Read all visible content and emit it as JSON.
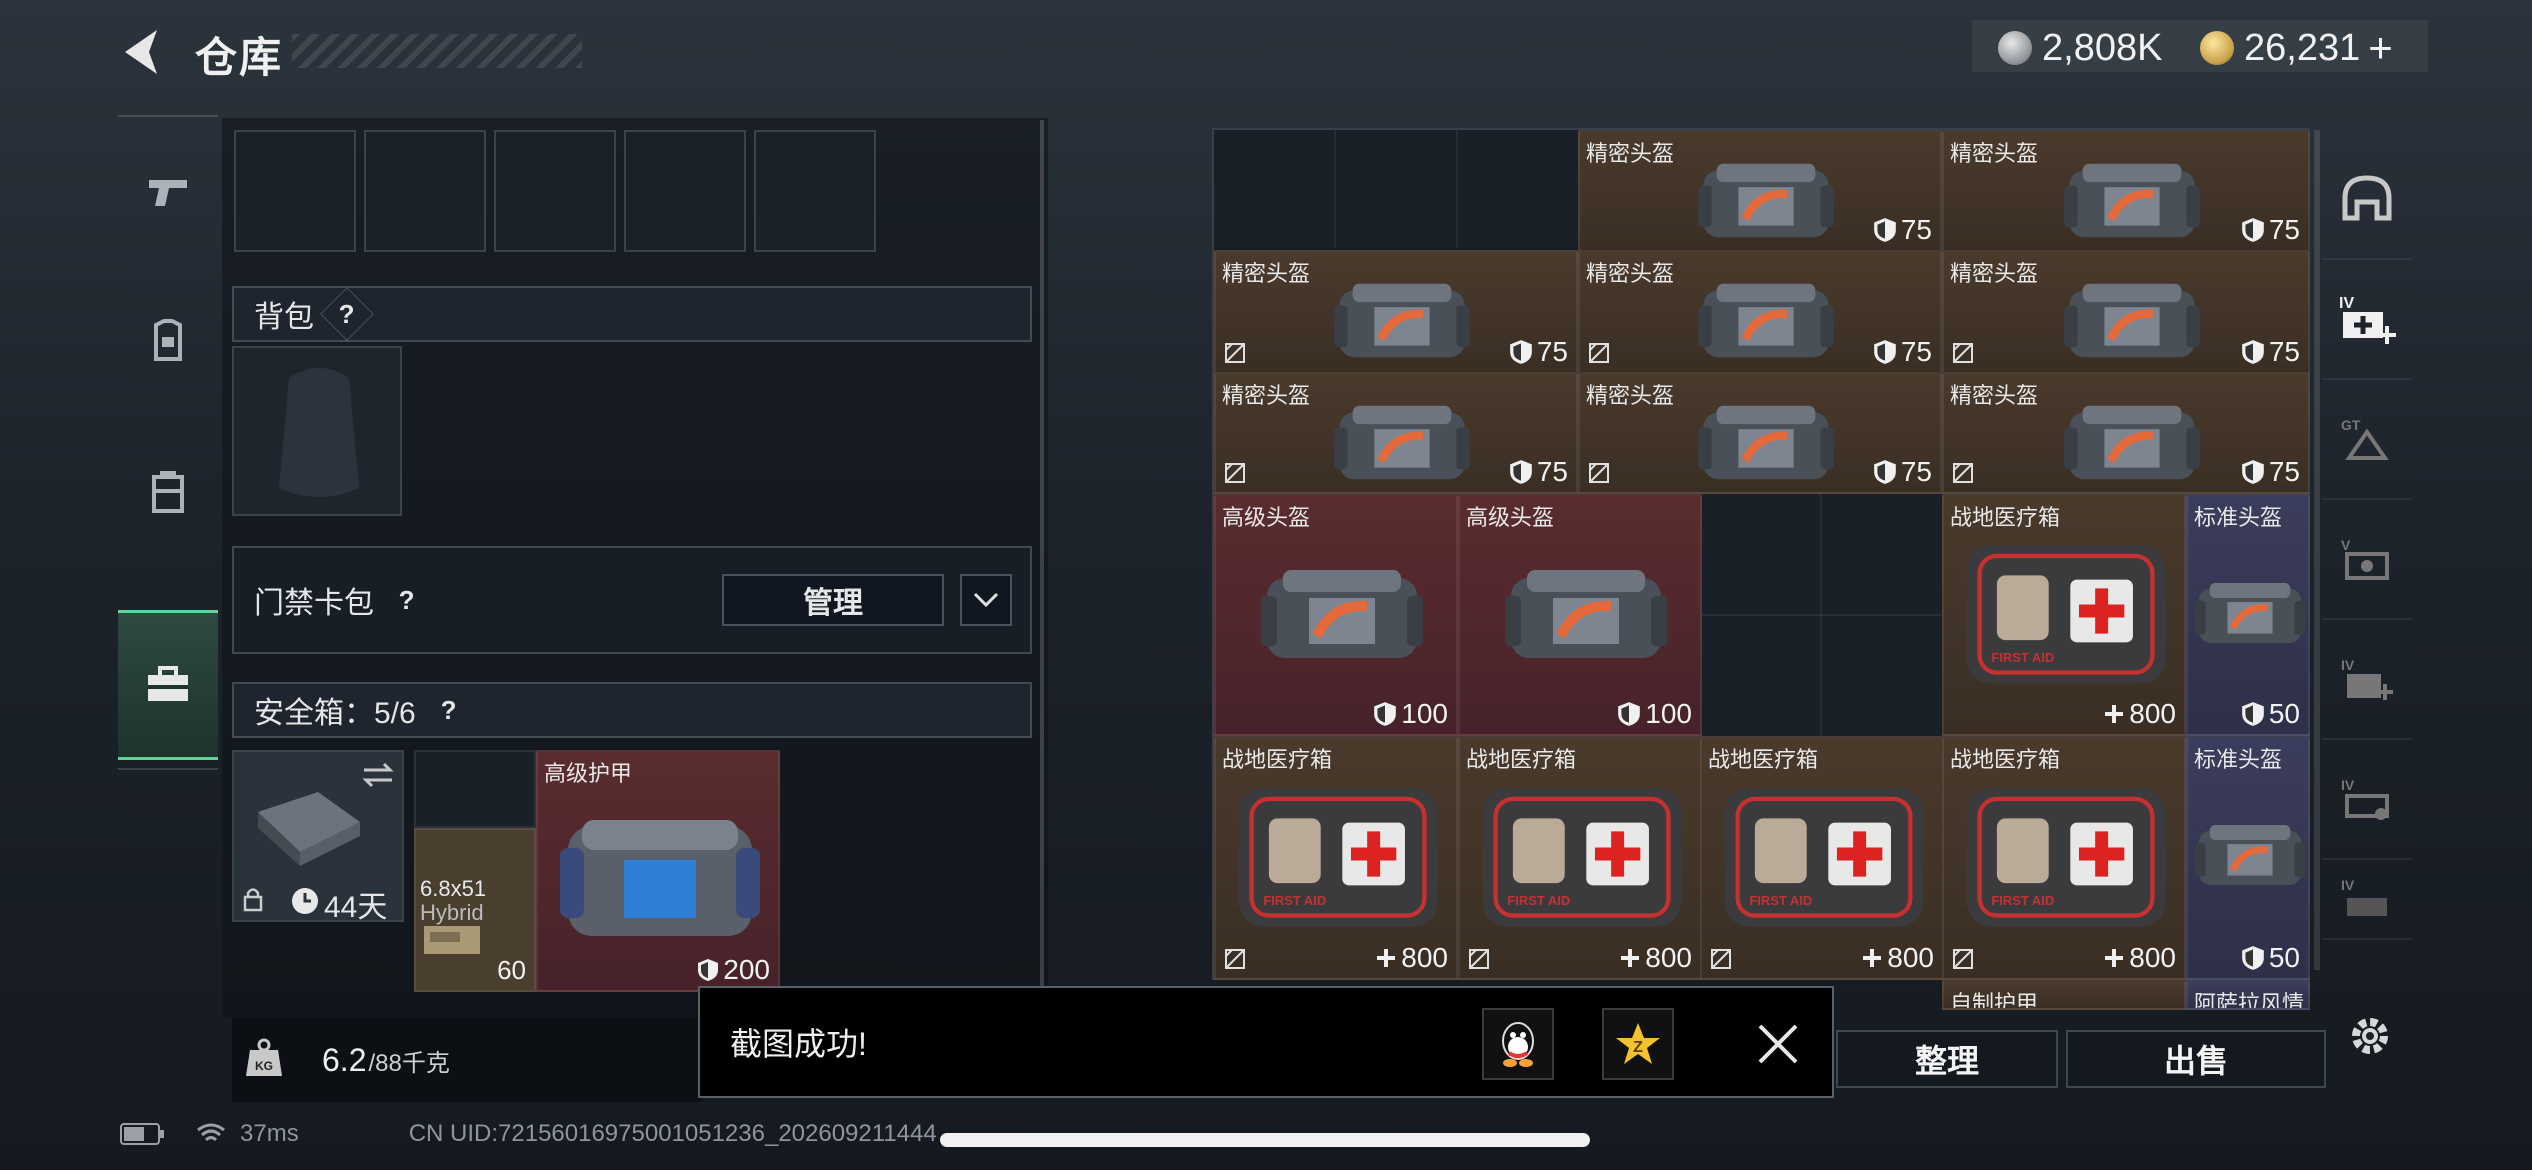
{
  "header": {
    "title": "仓库",
    "currency_silver": "2,808K",
    "currency_gold": "26,231",
    "gold_plus": "+"
  },
  "left": {
    "backpack_label": "背包",
    "help": "?",
    "access_label": "门禁卡包",
    "manage_label": "管理",
    "safe_label": "安全箱：5/6",
    "safe_case_time": "44天",
    "ammo_name": "6.8x51",
    "ammo_sub": "Hybrid",
    "ammo_count": "60",
    "armor_name": "高级护甲",
    "armor_value": "200",
    "weight_value": "6.2",
    "weight_cap": "/88千克"
  },
  "grid": {
    "items": [
      {
        "name": "精密头盔",
        "val": "75",
        "kind": "helmet",
        "color": "brown"
      },
      {
        "name": "精密头盔",
        "val": "75",
        "kind": "helmet",
        "color": "brown"
      },
      {
        "name": "精密头盔",
        "val": "75",
        "kind": "helmet",
        "color": "brown"
      },
      {
        "name": "精密头盔",
        "val": "75",
        "kind": "helmet",
        "color": "brown"
      },
      {
        "name": "精密头盔",
        "val": "75",
        "kind": "helmet",
        "color": "brown"
      },
      {
        "name": "精密头盔",
        "val": "75",
        "kind": "helmet",
        "color": "brown"
      },
      {
        "name": "精密头盔",
        "val": "75",
        "kind": "helmet",
        "color": "brown"
      },
      {
        "name": "精密头盔",
        "val": "75",
        "kind": "helmet",
        "color": "brown"
      },
      {
        "name": "高级头盔",
        "val": "100",
        "kind": "helmet",
        "color": "red"
      },
      {
        "name": "高级头盔",
        "val": "100",
        "kind": "helmet",
        "color": "red"
      },
      {
        "name": "战地医疗箱",
        "val": "800",
        "kind": "med",
        "color": "brown"
      },
      {
        "name": "标准头盔",
        "val": "50",
        "kind": "helmet",
        "color": "violet"
      },
      {
        "name": "战地医疗箱",
        "val": "800",
        "kind": "med",
        "color": "brown"
      },
      {
        "name": "战地医疗箱",
        "val": "800",
        "kind": "med",
        "color": "brown"
      },
      {
        "name": "战地医疗箱",
        "val": "800",
        "kind": "med",
        "color": "brown"
      },
      {
        "name": "战地医疗箱",
        "val": "800",
        "kind": "med",
        "color": "brown"
      },
      {
        "name": "标准头盔",
        "val": "50",
        "kind": "helmet",
        "color": "violet"
      },
      {
        "name": "自制护甲",
        "val": "",
        "kind": "partial",
        "color": "brown"
      },
      {
        "name": "阿萨拉风情",
        "val": "",
        "kind": "partial",
        "color": "violet"
      }
    ]
  },
  "toast": {
    "message": "截图成功!"
  },
  "buttons": {
    "sort": "整理",
    "sell": "出售"
  },
  "status": {
    "ping": "37ms",
    "uid": "CN UID:7215601697500105​1236_202609211444"
  }
}
